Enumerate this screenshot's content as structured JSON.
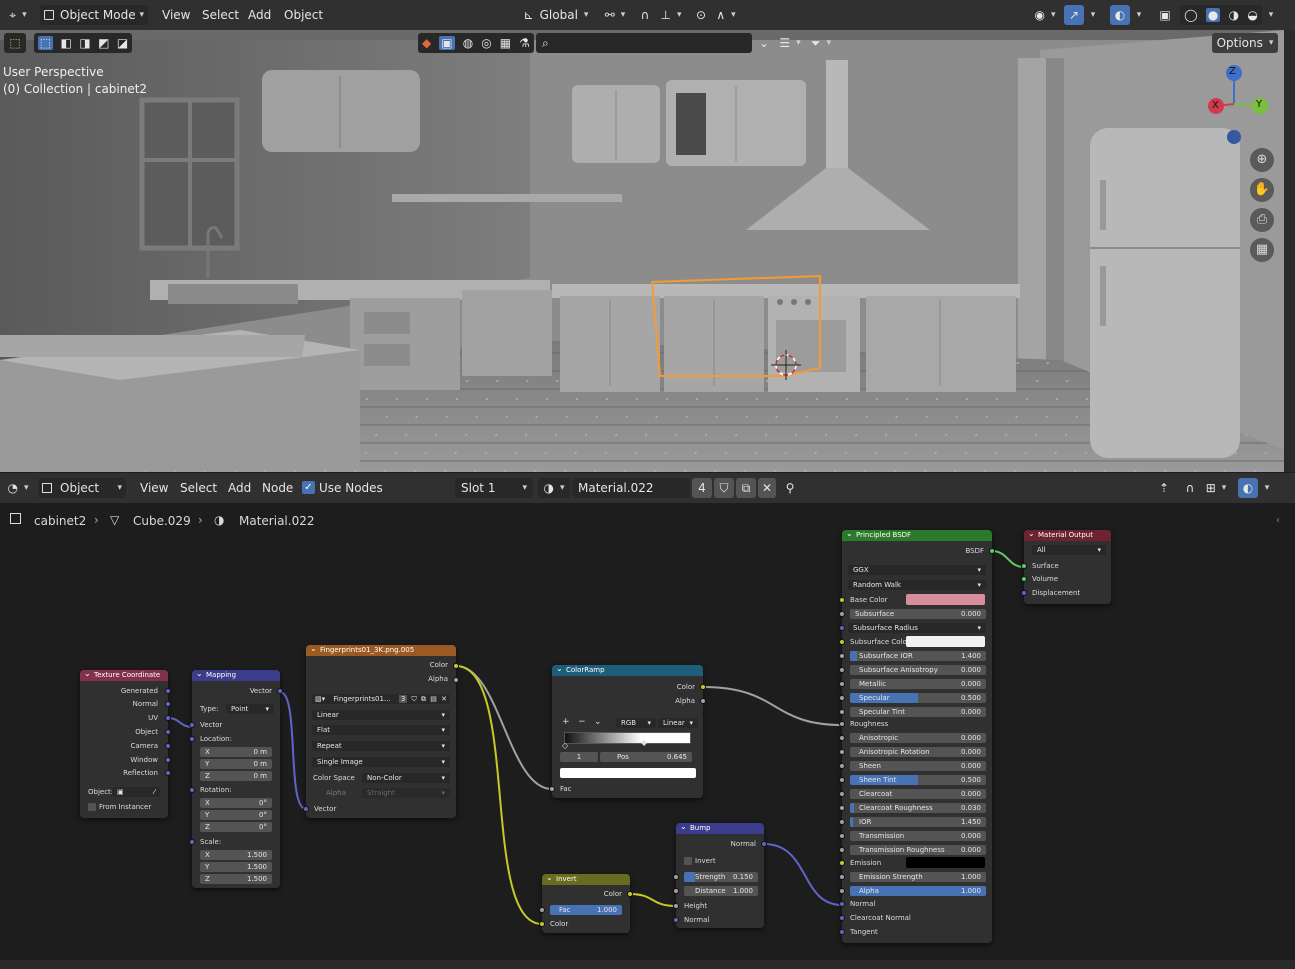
{
  "viewport_header": {
    "mode": "Object Mode",
    "menus": [
      "View",
      "Select",
      "Add",
      "Object"
    ],
    "transform_orientation": "Global",
    "options": "Options",
    "perspective": "User Perspective",
    "collection": "(0) Collection | cabinet2"
  },
  "gizmo": {
    "x": "X",
    "y": "Y",
    "z": "Z"
  },
  "node_header": {
    "type": "Object",
    "menus": [
      "View",
      "Select",
      "Add",
      "Node"
    ],
    "use_nodes": "Use Nodes",
    "slot": "Slot 1",
    "material": "Material.022",
    "users": "4"
  },
  "breadcrumb": {
    "object": "cabinet2",
    "mesh": "Cube.029",
    "material": "Material.022"
  },
  "nodes": {
    "texcoord": {
      "title": "Texture Coordinate",
      "outputs": [
        "Generated",
        "Normal",
        "UV",
        "Object",
        "Camera",
        "Window",
        "Reflection"
      ],
      "object_label": "Object:",
      "from_instancer": "From Instancer"
    },
    "mapping": {
      "title": "Mapping",
      "out": "Vector",
      "type_label": "Type:",
      "type_value": "Point",
      "vector": "Vector",
      "location": "Location:",
      "loc": [
        {
          "k": "X",
          "v": "0 m"
        },
        {
          "k": "Y",
          "v": "0 m"
        },
        {
          "k": "Z",
          "v": "0 m"
        }
      ],
      "rotation": "Rotation:",
      "rot": [
        {
          "k": "X",
          "v": "0°"
        },
        {
          "k": "Y",
          "v": "0°"
        },
        {
          "k": "Z",
          "v": "0°"
        }
      ],
      "scale": "Scale:",
      "scl": [
        {
          "k": "X",
          "v": "1.500"
        },
        {
          "k": "Y",
          "v": "1.500"
        },
        {
          "k": "Z",
          "v": "1.500"
        }
      ]
    },
    "image": {
      "title": "Fingerprints01_3K.png.005",
      "out_color": "Color",
      "out_alpha": "Alpha",
      "image_name": "Fingerprints01...",
      "image_users": "3",
      "interp": "Linear",
      "proj": "Flat",
      "ext": "Repeat",
      "source": "Single Image",
      "colorspace_label": "Color Space",
      "colorspace": "Non-Color",
      "alpha_label": "Alpha",
      "alpha_mode": "Straight",
      "in_vector": "Vector"
    },
    "colorramp": {
      "title": "ColorRamp",
      "out_color": "Color",
      "out_alpha": "Alpha",
      "mode": "RGB",
      "interp": "Linear",
      "index": "1",
      "pos_label": "Pos",
      "pos": "0.645",
      "fac": "Fac"
    },
    "invert": {
      "title": "Invert",
      "out": "Color",
      "fac_label": "Fac",
      "fac": "1.000",
      "in": "Color"
    },
    "bump": {
      "title": "Bump",
      "out": "Normal",
      "invert": "Invert",
      "strength_label": "Strength",
      "strength": "0.150",
      "strength_fill": 0.15,
      "distance_label": "Distance",
      "distance": "1.000",
      "height": "Height",
      "normal": "Normal"
    },
    "bsdf": {
      "title": "Principled BSDF",
      "out": "BSDF",
      "dist": "GGX",
      "sss": "Random Walk",
      "base_color_label": "Base Color",
      "base_color": "#d88d9c",
      "subsurface": {
        "k": "Subsurface",
        "v": "0.000"
      },
      "subsurface_radius": "Subsurface Radius",
      "subsurface_color_label": "Subsurface Color",
      "params": [
        {
          "k": "Subsurface IOR",
          "v": "1.400",
          "f": 0.05
        },
        {
          "k": "Subsurface Anisotropy",
          "v": "0.000",
          "f": 0
        },
        {
          "k": "Metallic",
          "v": "0.000",
          "f": 0
        },
        {
          "k": "Specular",
          "v": "0.500",
          "f": 0.5
        },
        {
          "k": "Specular Tint",
          "v": "0.000",
          "f": 0
        }
      ],
      "roughness": "Roughness",
      "params2": [
        {
          "k": "Anisotropic",
          "v": "0.000",
          "f": 0
        },
        {
          "k": "Anisotropic Rotation",
          "v": "0.000",
          "f": 0
        },
        {
          "k": "Sheen",
          "v": "0.000",
          "f": 0
        },
        {
          "k": "Sheen Tint",
          "v": "0.500",
          "f": 0.5
        },
        {
          "k": "Clearcoat",
          "v": "0.000",
          "f": 0
        },
        {
          "k": "Clearcoat Roughness",
          "v": "0.030",
          "f": 0.03
        },
        {
          "k": "IOR",
          "v": "1.450",
          "f": 0.02
        },
        {
          "k": "Transmission",
          "v": "0.000",
          "f": 0
        },
        {
          "k": "Transmission Roughness",
          "v": "0.000",
          "f": 0
        }
      ],
      "emission": "Emission",
      "emission_strength": {
        "k": "Emission Strength",
        "v": "1.000"
      },
      "alpha": {
        "k": "Alpha",
        "v": "1.000"
      },
      "normal": "Normal",
      "clearcoat_normal": "Clearcoat Normal",
      "tangent": "Tangent"
    },
    "output": {
      "title": "Material Output",
      "target": "All",
      "surface": "Surface",
      "volume": "Volume",
      "displacement": "Displacement"
    }
  }
}
